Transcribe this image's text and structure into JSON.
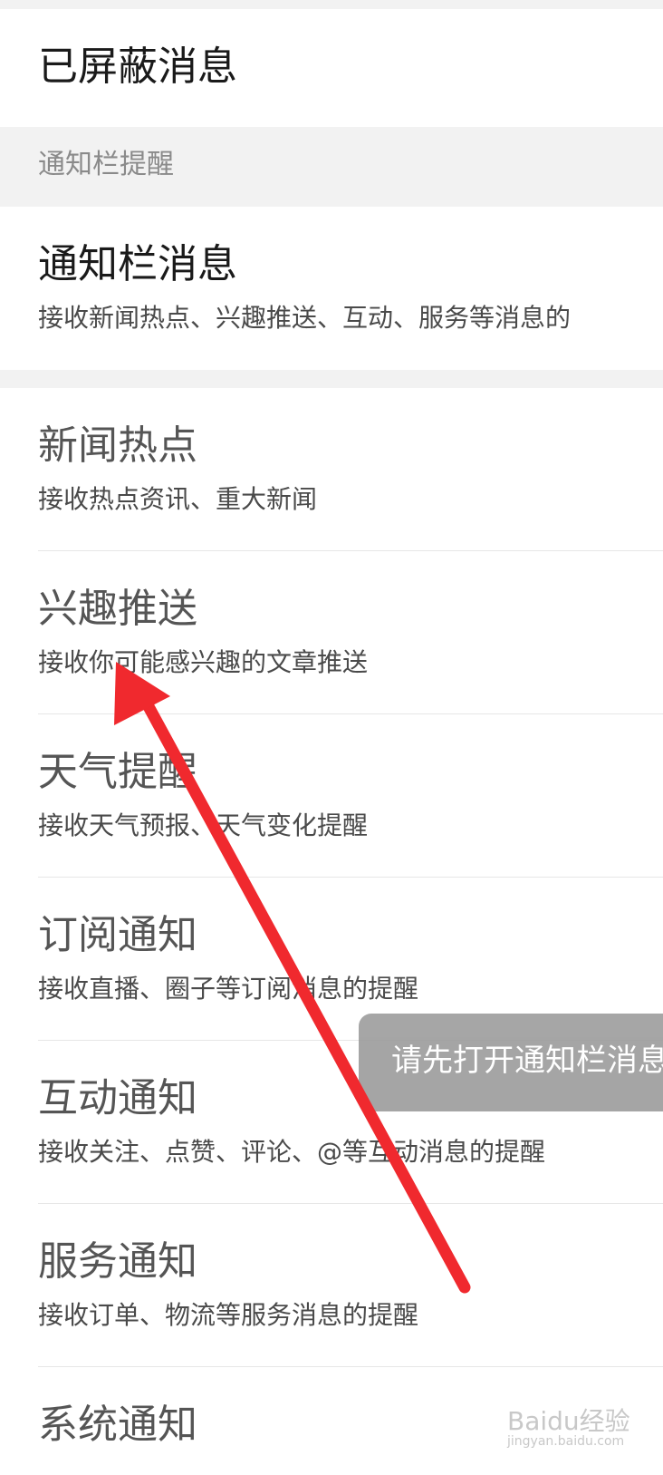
{
  "blocked_messages": {
    "label": "已屏蔽消息"
  },
  "notification_section": {
    "header": "通知栏提醒"
  },
  "notification_bar": {
    "title": "通知栏消息",
    "desc": "接收新闻热点、兴趣推送、互动、服务等消息的"
  },
  "settings": [
    {
      "title": "新闻热点",
      "desc": "接收热点资讯、重大新闻"
    },
    {
      "title": "兴趣推送",
      "desc": "接收你可能感兴趣的文章推送"
    },
    {
      "title": "天气提醒",
      "desc": "接收天气预报、天气变化提醒"
    },
    {
      "title": "订阅通知",
      "desc": "接收直播、圈子等订阅消息的提醒"
    },
    {
      "title": "互动通知",
      "desc": "接收关注、点赞、评论、@等互动消息的提醒"
    },
    {
      "title": "服务通知",
      "desc": "接收订单、物流等服务消息的提醒"
    },
    {
      "title": "系统通知",
      "desc": ""
    }
  ],
  "toast": {
    "text": "请先打开通知栏消息"
  },
  "watermark": {
    "brand": "Baidu经验",
    "url": "jingyan.baidu.com"
  },
  "colors": {
    "arrow": "#f0292e",
    "band": "#f2f2f2",
    "toast": "#9e9e9e"
  }
}
